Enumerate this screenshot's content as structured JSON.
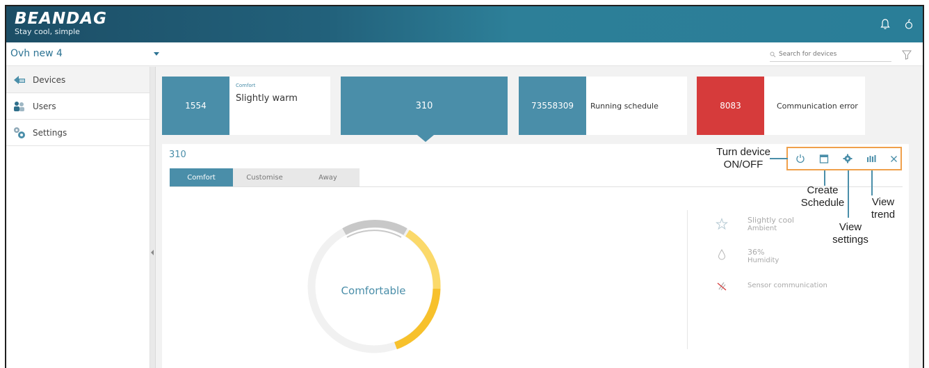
{
  "header": {
    "brand": "BEANDAG",
    "tagline": "Stay cool, simple"
  },
  "site": {
    "selected": "Ovh new 4"
  },
  "search": {
    "placeholder": "Search for devices"
  },
  "sidebar": {
    "items": [
      {
        "label": "Devices",
        "icon": "devices-icon"
      },
      {
        "label": "Users",
        "icon": "users-icon"
      },
      {
        "label": "Settings",
        "icon": "settings-icon"
      }
    ]
  },
  "cards": [
    {
      "id": "1554",
      "subtitle": "Comfort",
      "text": "Slightly warm"
    },
    {
      "id": "310"
    },
    {
      "id": "73558309",
      "text": "Running schedule"
    },
    {
      "id": "8083",
      "text": "Communication error"
    }
  ],
  "panel": {
    "device_id": "310",
    "tabs": [
      "Comfort",
      "Customise",
      "Away"
    ],
    "gauge_label": "Comfortable",
    "info": {
      "ambient_value": "Slightly cool",
      "ambient_label": "Ambient",
      "humidity_value": "36%",
      "humidity_label": "Humidity",
      "sensor_text": "Sensor communication"
    }
  },
  "callouts": {
    "turn_on_off_1": "Turn device",
    "turn_on_off_2": "ON/OFF",
    "create_schedule_1": "Create",
    "create_schedule_2": "Schedule",
    "view_settings_1": "View",
    "view_settings_2": "settings",
    "view_trend_1": "View",
    "view_trend_2": "trend"
  },
  "colors": {
    "primary": "#4a8ea9",
    "error": "#d63b3b",
    "header": "#22617b",
    "highlight": "#f0a04b"
  }
}
